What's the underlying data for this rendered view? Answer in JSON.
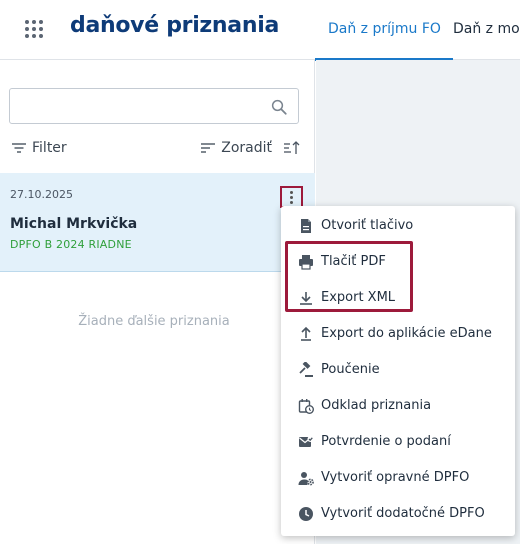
{
  "header": {
    "app_title": "daňové priznania",
    "tabs": [
      {
        "label": "Daň z príjmu FO",
        "active": true
      },
      {
        "label": "Daň z moto"
      }
    ]
  },
  "sidebar": {
    "search": {
      "placeholder": "",
      "value": ""
    },
    "filter_label": "Filter",
    "sort_label": "Zoradiť",
    "items": [
      {
        "date": "27.10.2025",
        "name": "Michal Mrkvička",
        "type": "DPFO B 2024 RIADNE"
      }
    ],
    "empty_text": "Žiadne ďalšie priznania"
  },
  "context_menu": {
    "items": [
      {
        "label": "Otvoriť tlačivo",
        "icon": "document-icon"
      },
      {
        "label": "Tlačiť PDF",
        "icon": "print-icon"
      },
      {
        "label": "Export XML",
        "icon": "download-icon"
      },
      {
        "label": "Export do aplikácie eDane",
        "icon": "upload-icon"
      },
      {
        "label": "Poučenie",
        "icon": "gavel-icon"
      },
      {
        "label": "Odklad priznania",
        "icon": "calendar-clock-icon"
      },
      {
        "label": "Potvrdenie o podaní",
        "icon": "mail-check-icon"
      },
      {
        "label": "Vytvoriť opravné DPFO",
        "icon": "user-gear-icon"
      },
      {
        "label": "Vytvoriť dodatočné DPFO",
        "icon": "clock-icon"
      }
    ]
  },
  "colors": {
    "brand_title": "#0e3b78",
    "accent_blue": "#1a79c9",
    "highlight_border": "#9d1a3b",
    "status_green": "#2f9f3a",
    "selected_bg": "#e3f1fa"
  }
}
